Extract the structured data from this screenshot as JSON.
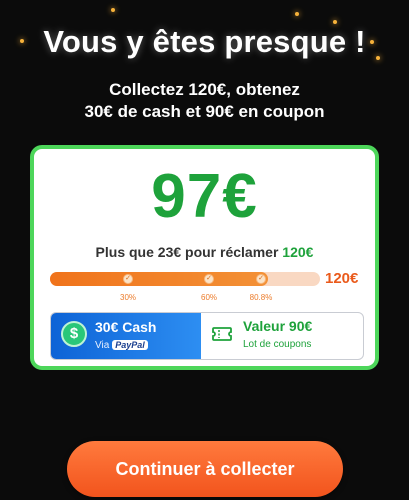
{
  "header": {
    "title": "Vous y êtes presque !",
    "subtitle_line1": "Collectez 120€, obtenez",
    "subtitle_line2": "30€ de cash et 90€ en coupon"
  },
  "card": {
    "amount": "97€",
    "remaining_text": "Plus que 23€ pour réclamer",
    "remaining_target": "120€",
    "goal_label": "120€",
    "progress": 0.808,
    "milestones": [
      "30%",
      "60%",
      "80.8%"
    ],
    "cash": {
      "icon": "coin-dollar-icon",
      "label": "30€ Cash",
      "via": "Via",
      "provider": "PayPal"
    },
    "coupon": {
      "icon": "ticket-icon",
      "label": "Valeur 90€",
      "sub": "Lot de coupons"
    }
  },
  "cta": {
    "label": "Continuer à collecter"
  },
  "colors": {
    "accent_green": "#1ea23b",
    "border_green": "#4dd65a",
    "progress_orange": "#f0731b",
    "goal_orange": "#ea5a1b",
    "cash_blue": "#0d63d6",
    "cta_orange": "#f2541d",
    "background": "#0b0b0b"
  }
}
